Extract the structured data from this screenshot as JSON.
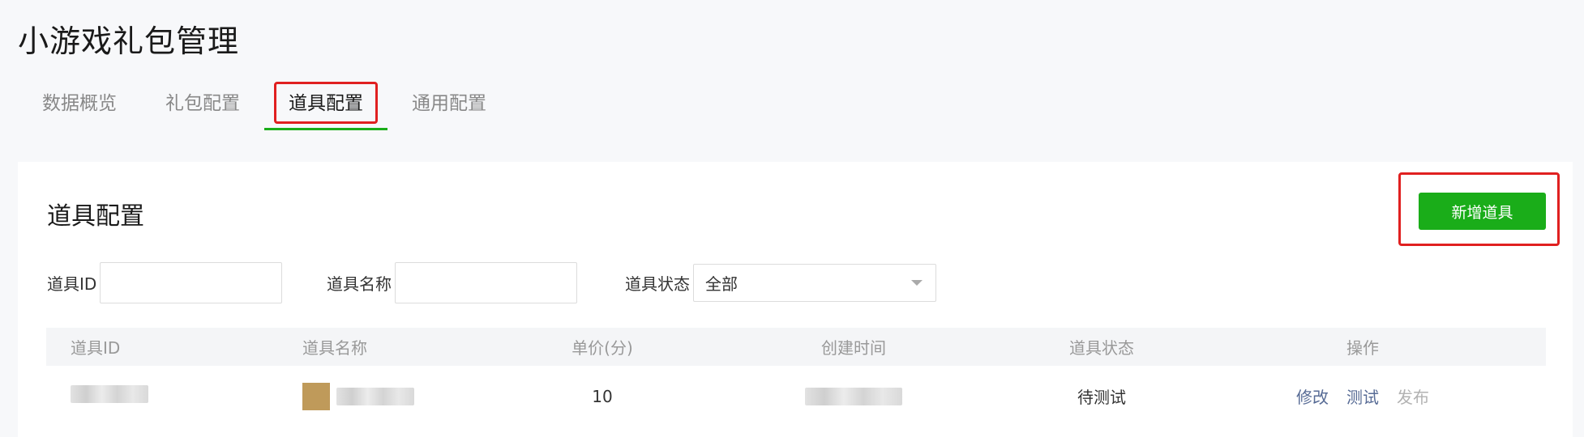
{
  "page": {
    "title": "小游戏礼包管理"
  },
  "tabs": [
    {
      "label": "数据概览",
      "active": false
    },
    {
      "label": "礼包配置",
      "active": false
    },
    {
      "label": "道具配置",
      "active": true
    },
    {
      "label": "通用配置",
      "active": false
    }
  ],
  "section": {
    "title": "道具配置",
    "add_button_label": "新增道具"
  },
  "filters": {
    "item_id_label": "道具ID",
    "item_id_value": "",
    "item_name_label": "道具名称",
    "item_name_value": "",
    "status_label": "道具状态",
    "status_value": "全部"
  },
  "table": {
    "headers": {
      "id": "道具ID",
      "name": "道具名称",
      "price": "单价(分)",
      "created": "创建时间",
      "status": "道具状态",
      "actions": "操作"
    },
    "rows": [
      {
        "id": "",
        "name": "",
        "price": "10",
        "created": "",
        "status": "待测试",
        "actions": {
          "edit": "修改",
          "test": "测试",
          "publish": "发布"
        }
      }
    ]
  },
  "colors": {
    "accent": "#1aad19",
    "highlight": "#e02020",
    "link": "#576b95",
    "thumb": "#bf9a5a"
  }
}
